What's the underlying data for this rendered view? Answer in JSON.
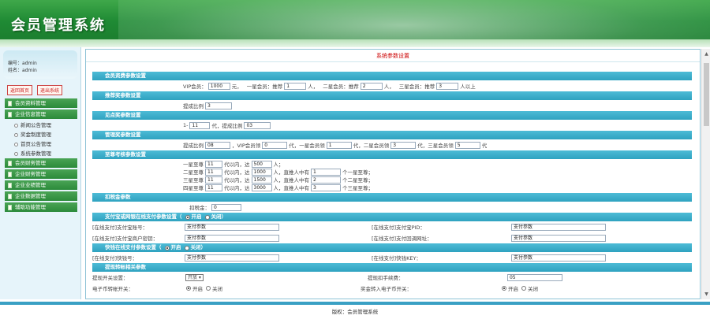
{
  "header": {
    "title": "会员管理系统"
  },
  "sidebar": {
    "user_id": "编号：admin",
    "user_name": "姓名：admin",
    "btn_home": "返回首页",
    "btn_exit": "退出系统",
    "menu": [
      "会员资料管理",
      "企业信息管理",
      "新闻公告管理",
      "奖金制度管理",
      "首页公告管理",
      "系统参数管理",
      "会员财务管理",
      "企业财务管理",
      "企业业绩管理",
      "企业数据管理",
      "辅助功能管理"
    ]
  },
  "main": {
    "page_title": "系统参数设置",
    "sec1": "会员资费参数设置",
    "r1": {
      "vip_label": "VIP会员：",
      "vip_val": "1000",
      "unit_yuan": "元，",
      "l1_label": "一星会员：推荐",
      "l1_val": "1",
      "unit_ren1": "人，",
      "l2_label": "二星会员：推荐",
      "l2_val": "2",
      "unit_ren2": "人，",
      "l3_label": "三星会员：推荐",
      "l3_val": "3",
      "unit_ren3": "人以上"
    },
    "sec2": "推荐奖参数设置",
    "r2": {
      "label": "提成比例",
      "val": "3"
    },
    "sec3": "见点奖参数设置",
    "r3": {
      "p1": "1-",
      "v1": "11",
      "p2": "代，提成比例",
      "v2": "03"
    },
    "sec4": "管理奖参数设置",
    "r4": {
      "p1": "提成比例",
      "v1": "08",
      "p2": "，VIP会员领",
      "v2": "0",
      "p3": "代，一星会员领",
      "v3": "1",
      "p4": "代，二星会员领",
      "v4": "3",
      "p5": "代，三星会员领",
      "v5": "5",
      "p6": "代"
    },
    "sec5": "至尊考核参数设置",
    "r5": [
      {
        "a": "一星至尊",
        "b": "11",
        "c": "代以内，达",
        "d": "500",
        "e": "人；",
        "f": "",
        "g": "",
        "h": ""
      },
      {
        "a": "二星至尊",
        "b": "11",
        "c": "代以内，达",
        "d": "1000",
        "e": "人，直推人中有",
        "f": "1",
        "g": "个一星至尊；",
        "h": ""
      },
      {
        "a": "三星至尊",
        "b": "11",
        "c": "代以内，达",
        "d": "1500",
        "e": "人，直推人中有",
        "f": "2",
        "g": "个二星至尊；",
        "h": ""
      },
      {
        "a": "四星至尊",
        "b": "11",
        "c": "代以内，达",
        "d": "3000",
        "e": "人，直推人中有",
        "f": "3",
        "g": "个三星至尊；",
        "h": ""
      }
    ],
    "sec6": "扣税金参数",
    "r6": {
      "label": "扣税金：",
      "val": "0"
    },
    "sec7": "支付宝或网银在线支付参数设置（",
    "sec7_on": "开启",
    "sec7_off": "关闭）",
    "r7a": {
      "l1": "[在线支付]支付宝账号：",
      "v1": "支付参数",
      "l2": "[在线支付]支付宝PID：",
      "v2": "支付参数"
    },
    "r7b": {
      "l1": "[在线支付]支付宝商户密钥：",
      "v1": "支付参数",
      "l2": "[在线支付]支付回调网址：",
      "v2": "支付参数"
    },
    "sec8": "快钱在线支付参数设置（",
    "sec8_on": "开启",
    "sec8_off": "关闭）",
    "r8": {
      "l1": "[在线支付]快钱号：",
      "v1": "支付参数",
      "l2": "[在线支付]快钱KEY：",
      "v2": "支付参数"
    },
    "sec9": "提现转帐相关参数",
    "r9a": {
      "l1": "提现开关设置：",
      "v1": "开放",
      "l2": "提现扣手续费：",
      "v2": "05"
    },
    "r9b": {
      "l1": "电子币转帐开关：",
      "on1": "开启",
      "off1": "关闭",
      "l2": "奖金转入电子币开关：",
      "on2": "开启",
      "off2": "关闭"
    }
  },
  "footer": {
    "text": "版权：会员管理系统"
  }
}
